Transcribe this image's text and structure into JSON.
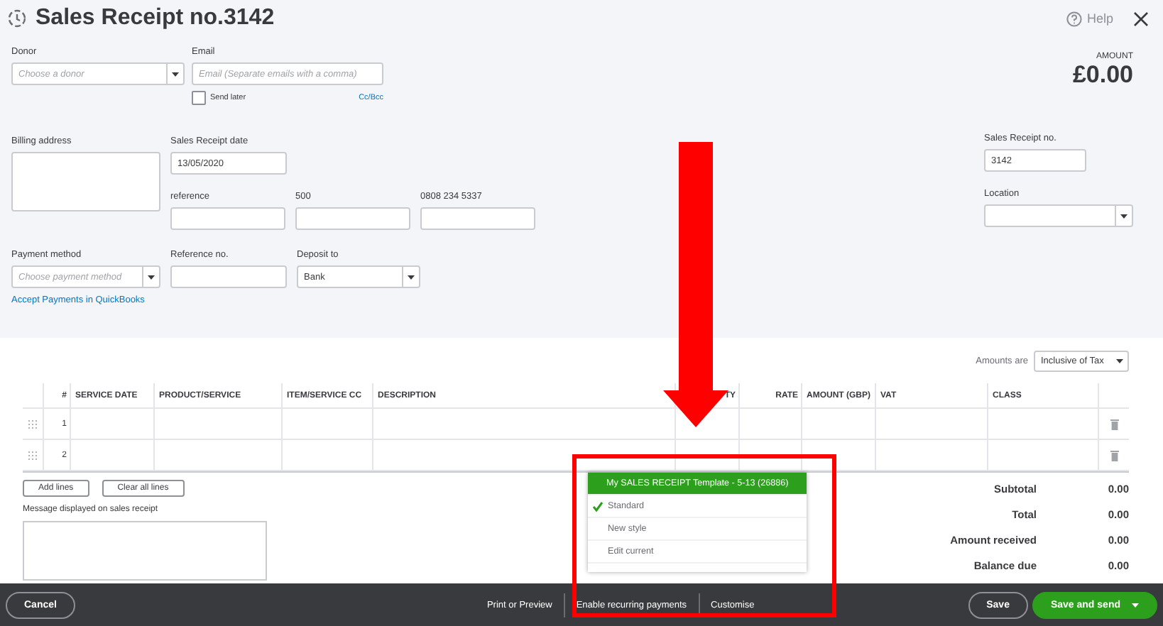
{
  "header": {
    "title": "Sales Receipt no.3142",
    "help": "Help"
  },
  "form": {
    "donor": {
      "label": "Donor",
      "placeholder": "Choose a donor"
    },
    "email": {
      "label": "Email",
      "placeholder": "Email (Separate emails with a comma)"
    },
    "send_later": {
      "label": "Send later",
      "checked": false
    },
    "cc_bcc": "Cc/Bcc",
    "billing_address": {
      "label": "Billing address"
    },
    "date": {
      "label": "Sales Receipt date",
      "value": "13/05/2020"
    },
    "custom_fields": [
      {
        "label": "reference"
      },
      {
        "label": "500"
      },
      {
        "label": "0808 234 5337"
      }
    ],
    "payment_method": {
      "label": "Payment method",
      "placeholder": "Choose payment method"
    },
    "reference_no": {
      "label": "Reference no."
    },
    "deposit_to": {
      "label": "Deposit to",
      "value": "Bank"
    },
    "accept_payments": "Accept Payments in QuickBooks"
  },
  "amount": {
    "label": "AMOUNT",
    "value": "£0.00"
  },
  "receipt_no": {
    "label": "Sales Receipt no.",
    "value": "3142"
  },
  "location": {
    "label": "Location"
  },
  "amounts_are": {
    "label": "Amounts are",
    "value": "Inclusive of Tax"
  },
  "table": {
    "columns": [
      "#",
      "SERVICE DATE",
      "PRODUCT/SERVICE",
      "ITEM/SERVICE CC",
      "DESCRIPTION",
      "TY",
      "RATE",
      "AMOUNT (GBP)",
      "VAT",
      "CLASS"
    ],
    "rows": [
      {
        "number": "1"
      },
      {
        "number": "2"
      }
    ]
  },
  "line_buttons": [
    "Add lines",
    "Clear all lines"
  ],
  "message": {
    "label": "Message displayed on sales receipt"
  },
  "totals": [
    {
      "label": "Subtotal",
      "value": "0.00"
    },
    {
      "label": "Total",
      "value": "0.00"
    },
    {
      "label": "Amount received",
      "value": "0.00"
    },
    {
      "label": "Balance due",
      "value": "0.00"
    }
  ],
  "template_menu": [
    {
      "label": "My SALES RECEIPT Template - 5-13 (26886)",
      "selected": true,
      "checked": false
    },
    {
      "label": "Standard",
      "selected": false,
      "checked": true
    },
    {
      "label": "New style",
      "selected": false,
      "checked": false
    },
    {
      "label": "Edit current",
      "selected": false,
      "checked": false
    }
  ],
  "footer": {
    "cancel": "Cancel",
    "links": [
      "Print or Preview",
      "Enable recurring payments",
      "Customise"
    ],
    "save": "Save",
    "save_and_send": "Save and send"
  }
}
